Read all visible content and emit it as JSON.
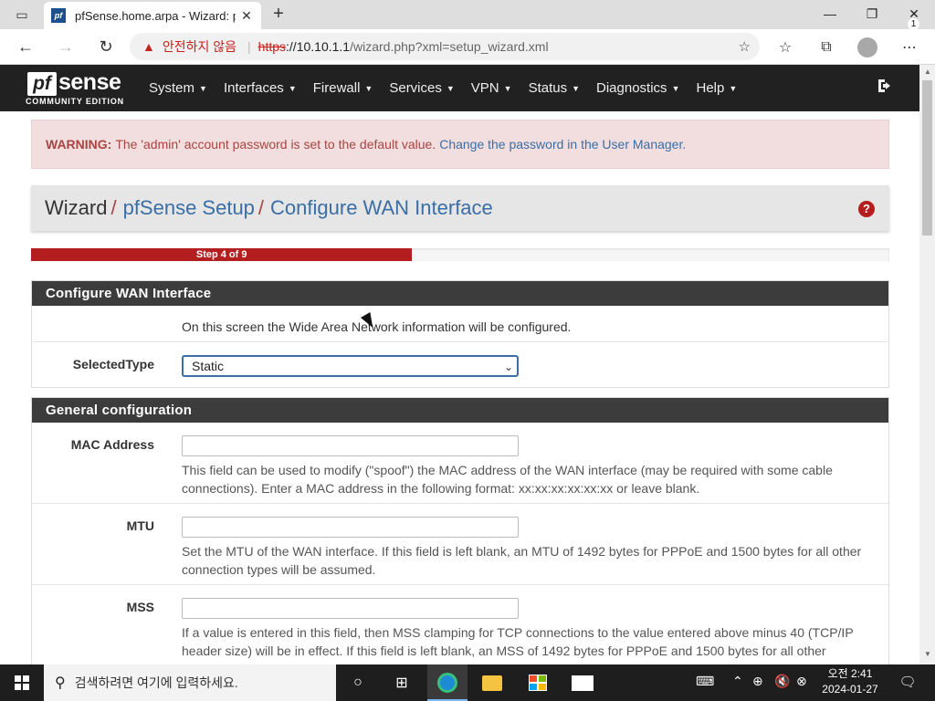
{
  "browser": {
    "tab_title": "pfSense.home.arpa - Wizard: pfSense Setup: Configure WAN Interface",
    "tab_favicon_text": "pf",
    "not_secure_label": "안전하지 않음",
    "url_scheme": "https",
    "url_host": "://10.10.1.1",
    "url_path": "/wizard.php?xml=setup_wizard.xml",
    "icons": [
      "tab-actions-icon",
      "close-icon",
      "plus-icon",
      "minimize-icon",
      "restore-icon",
      "close-window-icon",
      "back-arrow-icon",
      "forward-arrow-icon",
      "refresh-icon",
      "warning-icon",
      "favorite-add-icon",
      "favorites-icon",
      "collections-icon",
      "profile-icon",
      "more-icon"
    ]
  },
  "navbar": {
    "logo_pf": "pf",
    "logo_sense": "sense",
    "logo_edition": "COMMUNITY EDITION",
    "menu": [
      "System",
      "Interfaces",
      "Firewall",
      "Services",
      "VPN",
      "Status",
      "Diagnostics",
      "Help"
    ]
  },
  "alert": {
    "label": "WARNING:",
    "text": "The 'admin' account password is set to the default value.",
    "link": "Change the password in the User Manager."
  },
  "breadcrumb": {
    "root": "Wizard",
    "sep": "/",
    "level1": "pfSense Setup",
    "level2": "Configure WAN Interface",
    "help_glyph": "?"
  },
  "progress": {
    "label": "Step 4 of 9",
    "fraction": 0.444,
    "color": "#b41e1e"
  },
  "wan_panel": {
    "title": "Configure WAN Interface",
    "intro": "On this screen the Wide Area Network information will be configured.",
    "selected_type_label": "SelectedType",
    "selected_type_value": "Static"
  },
  "general_panel": {
    "title": "General configuration",
    "mac_label": "MAC Address",
    "mac_value": "",
    "mac_help": "This field can be used to modify (\"spoof\") the MAC address of the WAN interface (may be required with some cable connections). Enter a MAC address in the following format: xx:xx:xx:xx:xx:xx or leave blank.",
    "mtu_label": "MTU",
    "mtu_value": "",
    "mtu_help": "Set the MTU of the WAN interface. If this field is left blank, an MTU of 1492 bytes for PPPoE and 1500 bytes for all other connection types will be assumed.",
    "mss_label": "MSS",
    "mss_value": "",
    "mss_help": "If a value is entered in this field, then MSS clamping for TCP connections to the value entered above minus 40 (TCP/IP header size) will be in effect. If this field is left blank, an MSS of 1492 bytes for PPPoE and 1500 bytes for all other"
  },
  "taskbar": {
    "search_placeholder": "검색하려면 여기에 입력하세요.",
    "clock_period": "오전 2:41",
    "clock_date": "2024-01-27",
    "notification_count": "1"
  }
}
